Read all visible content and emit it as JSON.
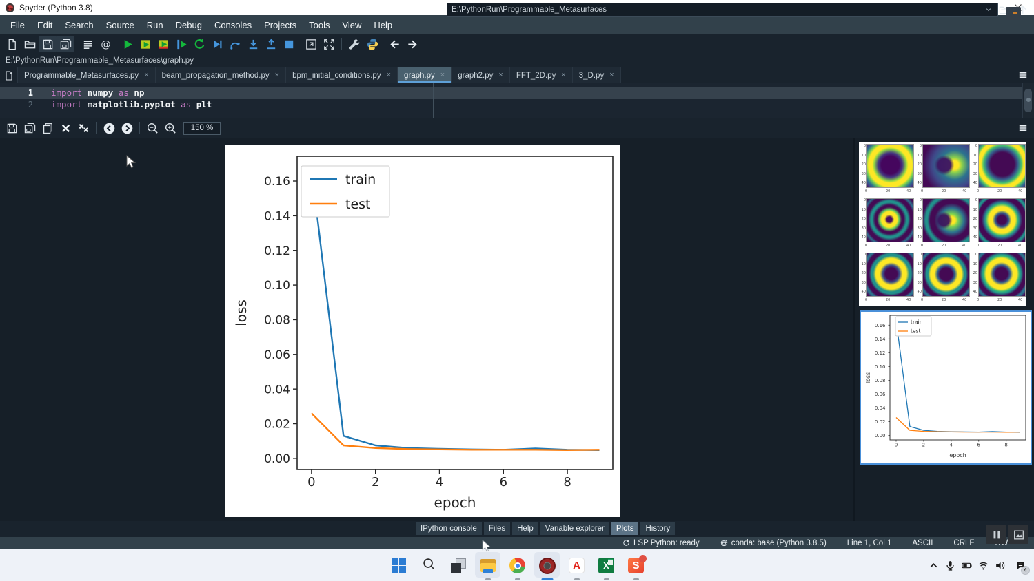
{
  "window": {
    "title": "Spyder (Python 3.8)",
    "controls": [
      "minimize",
      "maximize",
      "close"
    ]
  },
  "menubar": {
    "items": [
      "File",
      "Edit",
      "Search",
      "Source",
      "Run",
      "Debug",
      "Consoles",
      "Projects",
      "Tools",
      "View",
      "Help"
    ]
  },
  "toolbar": {
    "working_directory": "E:\\PythonRun\\Programmable_Metasurfaces",
    "buttons": [
      "new-file",
      "open-file",
      "save-file",
      "save-all",
      "file-switcher",
      "symbol-finder",
      "run-file",
      "run-cell",
      "run-cell-advance",
      "run-selection",
      "rerun-cell",
      "debug-file",
      "step-over",
      "step-into",
      "step-out",
      "stop-debug",
      "maximize-pane",
      "fullscreen",
      "preferences",
      "python-path",
      "back",
      "forward"
    ]
  },
  "breadcrumb": {
    "path": "E:\\PythonRun\\Programmable_Metasurfaces\\graph.py"
  },
  "editor": {
    "tabs": [
      {
        "label": "Programmable_Metasurfaces.py",
        "active": false
      },
      {
        "label": "beam_propagation_method.py",
        "active": false
      },
      {
        "label": "bpm_initial_conditions.py",
        "active": false
      },
      {
        "label": "graph.py",
        "active": true
      },
      {
        "label": "graph2.py",
        "active": false
      },
      {
        "label": "FFT_2D.py",
        "active": false
      },
      {
        "label": "3_D.py",
        "active": false
      }
    ],
    "close_glyph": "×",
    "lines": [
      {
        "number": "1",
        "current": true,
        "tokens": [
          [
            "import ",
            "kw"
          ],
          [
            "numpy ",
            "pl"
          ],
          [
            "as ",
            "kw"
          ],
          [
            "np",
            "pl"
          ]
        ]
      },
      {
        "number": "2",
        "current": false,
        "tokens": [
          [
            "import ",
            "kw"
          ],
          [
            "matplotlib.pyplot ",
            "pl"
          ],
          [
            "as ",
            "kw"
          ],
          [
            "plt",
            "pl"
          ]
        ]
      }
    ]
  },
  "plots_toolbar": {
    "zoom_value": "150 %",
    "buttons": [
      "save-plot",
      "save-all-plots",
      "copy-plot",
      "close-plot",
      "close-all-plots",
      "previous-plot",
      "next-plot",
      "zoom-out",
      "zoom-in"
    ]
  },
  "chart_data": {
    "type": "line",
    "title": "",
    "xlabel": "epoch",
    "ylabel": "loss",
    "x": [
      0,
      1,
      2,
      3,
      4,
      5,
      6,
      7,
      8,
      9
    ],
    "series": [
      {
        "name": "train",
        "color": "#1f77b4",
        "values": [
          0.167,
          0.013,
          0.0075,
          0.006,
          0.0055,
          0.0052,
          0.005,
          0.0057,
          0.005,
          0.0048
        ]
      },
      {
        "name": "test",
        "color": "#ff7f0e",
        "values": [
          0.026,
          0.0075,
          0.006,
          0.0054,
          0.0052,
          0.005,
          0.005,
          0.005,
          0.0048,
          0.005
        ]
      }
    ],
    "xticks": [
      0,
      2,
      4,
      6,
      8
    ],
    "yticks": [
      "0.00",
      "0.02",
      "0.04",
      "0.06",
      "0.08",
      "0.10",
      "0.12",
      "0.14",
      "0.16"
    ],
    "xlim": [
      -0.45,
      9.42
    ],
    "ylim": [
      -0.0064,
      0.1743
    ],
    "legend_position": "upper left",
    "grid": false
  },
  "thumbnails": {
    "grid_plot": {
      "rows": 3,
      "cols": 3,
      "x_ticks": [
        "0",
        "20",
        "40"
      ],
      "y_ticks": [
        "0",
        "10",
        "20",
        "30",
        "40"
      ],
      "cells": [
        "thick-ring",
        "crescent-dark",
        "big-ring",
        "small-ring",
        "crescent-ring",
        "mid-ring",
        "donut-a",
        "donut-b",
        "donut-c"
      ]
    },
    "line_plot": {
      "selected": true
    }
  },
  "bottom_tabs": {
    "items": [
      "IPython console",
      "Files",
      "Help",
      "Variable explorer",
      "Plots",
      "History"
    ],
    "active": "Plots"
  },
  "statusbar": {
    "lsp": "LSP Python: ready",
    "conda": "conda: base (Python 3.8.5)",
    "cursor": "Line 1, Col 1",
    "encoding": "ASCII",
    "eol": "CRLF",
    "permissions": "RW"
  },
  "taskbar": {
    "badge_count": "4",
    "apps": [
      {
        "name": "start",
        "running": false,
        "highlighted": false,
        "active": false
      },
      {
        "name": "search",
        "running": false,
        "highlighted": false,
        "active": false
      },
      {
        "name": "task-view",
        "running": false,
        "highlighted": false,
        "active": false
      },
      {
        "name": "explorer",
        "running": true,
        "highlighted": true,
        "active": false
      },
      {
        "name": "chrome",
        "running": true,
        "highlighted": false,
        "active": false
      },
      {
        "name": "spyder",
        "running": true,
        "highlighted": true,
        "active": true
      },
      {
        "name": "acrobat",
        "running": true,
        "highlighted": false,
        "active": false
      },
      {
        "name": "excel",
        "running": true,
        "highlighted": false,
        "active": false
      },
      {
        "name": "sogou",
        "running": true,
        "highlighted": false,
        "active": false,
        "badge_dot": true
      }
    ],
    "tray": [
      "chevron-up",
      "microphone",
      "battery",
      "wifi",
      "volume",
      "notifications"
    ],
    "app_glyphs": {
      "acrobat": "A",
      "excel": "X",
      "sogou": "S"
    }
  }
}
